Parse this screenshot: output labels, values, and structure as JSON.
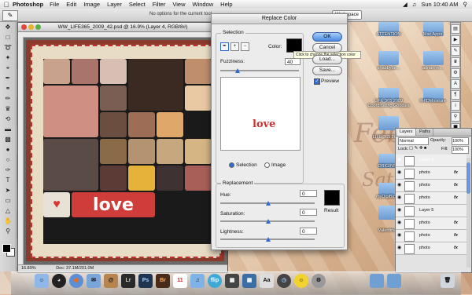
{
  "menubar": {
    "app_name": "Photoshop",
    "menus": [
      "File",
      "Edit",
      "Image",
      "Layer",
      "Select",
      "Filter",
      "View",
      "Window",
      "Help"
    ],
    "clock": "Sun 10:40 AM"
  },
  "options_bar": {
    "message": "No options for the current tool.",
    "workspace_label": "Workspace"
  },
  "document": {
    "title": "WW_LIFE365_2009_42.psd @ 16.9% (Layer 4, RGB/8#)",
    "zoom": "16.89%",
    "doc_size": "Doc: 37.1M/201.0M",
    "love_text": "love"
  },
  "dialog": {
    "title": "Replace Color",
    "selection_legend": "Selection",
    "color_label": "Color:",
    "tooltip": "Click to change the selection color",
    "fuzziness_label": "Fuzziness:",
    "fuzziness_value": "40",
    "preview_love": "love",
    "radio_selection": "Selection",
    "radio_image": "Image",
    "replacement_legend": "Replacement",
    "hue_label": "Hue:",
    "hue_value": "0",
    "saturation_label": "Saturation:",
    "saturation_value": "0",
    "lightness_label": "Lightness:",
    "lightness_value": "0",
    "result_label": "Result",
    "ok": "OK",
    "cancel": "Cancel",
    "load": "Load...",
    "save": "Save...",
    "preview": "Preview",
    "color_swatch": "#000000",
    "result_swatch": "#000000"
  },
  "desktop": {
    "icons": [
      "ATTENTION",
      "Mac Apps",
      "shabbyde...",
      "adrianne...",
      "kit/Lin...",
      "LIFE 365 2009 Coordinating Goodies",
      "#HIDMoisture",
      "ORIGINS",
      "LIFE 365 2008",
      "myDigiBlog",
      "Valentine"
    ]
  },
  "layers_panel": {
    "tabs": [
      "Layers",
      "Paths"
    ],
    "blend_mode": "Normal",
    "opacity_label": "Opacity:",
    "opacity_value": "100%",
    "lock_label": "Lock:",
    "fill_label": "Fill:",
    "fill_value": "100%",
    "layers": [
      {
        "name": "Layer 4",
        "fx": "",
        "selected": true
      },
      {
        "name": "photo",
        "fx": "fx",
        "selected": false
      },
      {
        "name": "photo",
        "fx": "fx",
        "selected": false
      },
      {
        "name": "photo",
        "fx": "fx",
        "selected": false
      },
      {
        "name": "Layer 5",
        "fx": "",
        "selected": false
      },
      {
        "name": "photo",
        "fx": "fx",
        "selected": false
      },
      {
        "name": "photo",
        "fx": "fx",
        "selected": false
      },
      {
        "name": "photo",
        "fx": "fx",
        "selected": false
      }
    ]
  },
  "dock": {
    "apps": [
      "Finder",
      "Dashboard",
      "Firefox",
      "Mail",
      "Address Book",
      "Lightroom",
      "Photoshop",
      "Bridge",
      "iCal",
      "iTunes",
      "Flip",
      "Photo Booth",
      "Expose",
      "Dictionary",
      "Time Machine",
      "Adium",
      "System Preferences",
      "Folder",
      "Folder",
      "Trash"
    ]
  }
}
